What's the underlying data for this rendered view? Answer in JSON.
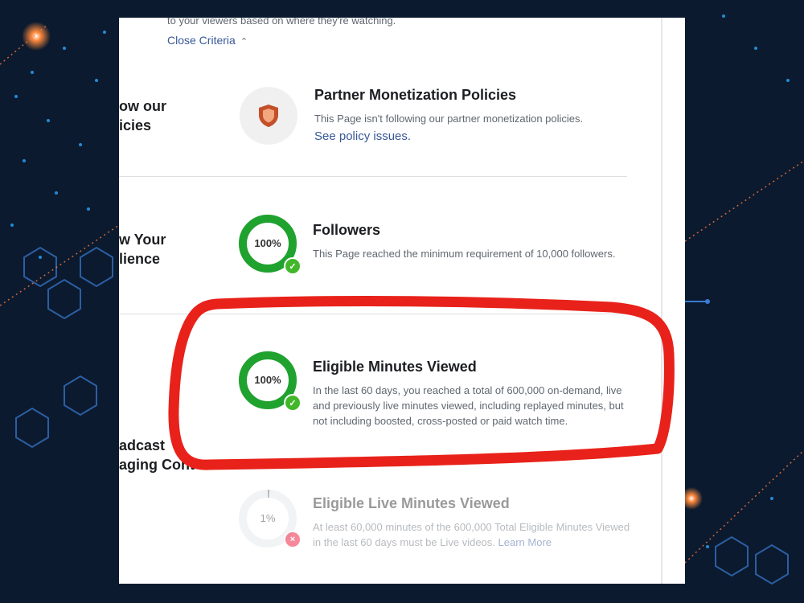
{
  "colors": {
    "accent_link": "#385898",
    "success_green": "#1fa22e",
    "fail_red": "#f02849",
    "annotation_red": "#e8221a",
    "shield_orange": "#c4502a"
  },
  "header": {
    "top_text": "to your viewers based on where they're watching.",
    "close_criteria": "Close Criteria"
  },
  "sections": {
    "policies_label": [
      "ow our",
      "icies"
    ],
    "audience_label": [
      "w Your",
      "lience"
    ],
    "broadcast_label": [
      "adcast",
      "aging Cont"
    ]
  },
  "items": {
    "partner": {
      "title": "Partner Monetization Policies",
      "desc": "This Page isn't following our partner monetization policies.",
      "link": "See policy issues.",
      "icon": "shield-icon"
    },
    "followers": {
      "percent_label": "100%",
      "progress": 1.0,
      "title": "Followers",
      "desc": "This Page reached the minimum requirement of 10,000 followers."
    },
    "minutes": {
      "percent_label": "100%",
      "progress": 1.0,
      "title": "Eligible Minutes Viewed",
      "desc": "In the last 60 days, you reached a total of 600,000 on-demand, live and previously live minutes viewed, including replayed minutes, but not including boosted, cross-posted or paid watch time."
    },
    "live": {
      "percent_label": "1%",
      "progress": 0.01,
      "title": "Eligible Live Minutes Viewed",
      "desc": "At least 60,000 minutes of the 600,000 Total Eligible Minutes Viewed in the last 60 days must be Live videos.",
      "link": "Learn More"
    }
  }
}
